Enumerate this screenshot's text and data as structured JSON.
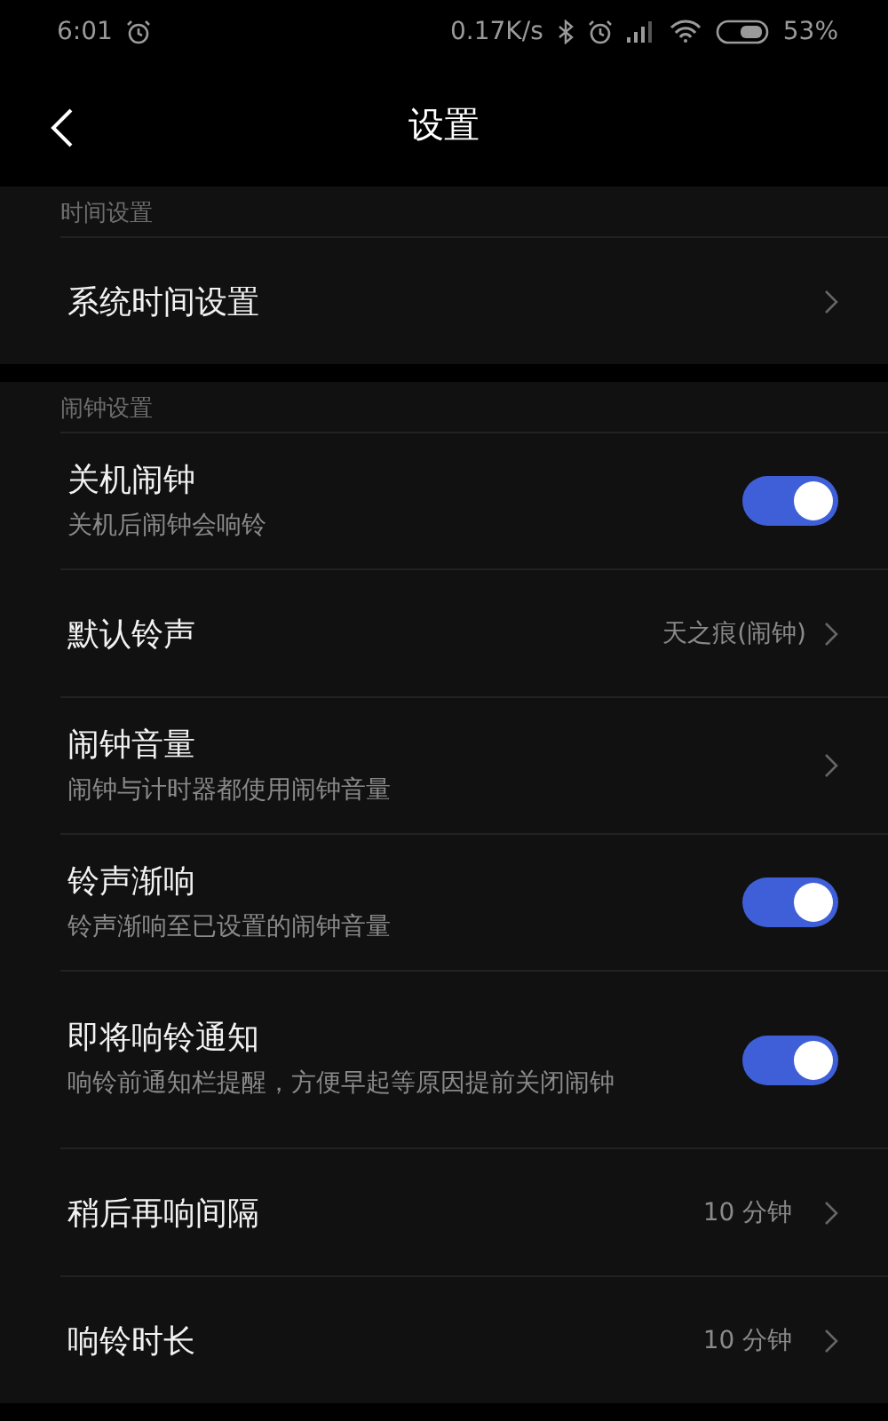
{
  "status_bar": {
    "time": "6:01",
    "speed": "0.17K/s",
    "battery": "53%"
  },
  "header": {
    "title": "设置"
  },
  "sections": [
    {
      "label": "时间设置",
      "items": [
        {
          "kind": "link",
          "title": "系统时间设置"
        }
      ]
    },
    {
      "label": "闹钟设置",
      "items": [
        {
          "kind": "toggle",
          "title": "关机闹钟",
          "subtitle": "关机后闹钟会响铃",
          "on": true
        },
        {
          "kind": "link",
          "title": "默认铃声",
          "value": "天之痕(闹钟)"
        },
        {
          "kind": "link",
          "title": "闹钟音量",
          "subtitle": "闹钟与计时器都使用闹钟音量"
        },
        {
          "kind": "toggle",
          "title": "铃声渐响",
          "subtitle": "铃声渐响至已设置的闹钟音量",
          "on": true
        },
        {
          "kind": "toggle",
          "title": "即将响铃通知",
          "subtitle": "响铃前通知栏提醒，方便早起等原因提前关闭闹钟",
          "on": true
        },
        {
          "kind": "link",
          "title": "稍后再响间隔",
          "value": "10 分钟"
        },
        {
          "kind": "link",
          "title": "响铃时长",
          "value": "10 分钟"
        }
      ]
    }
  ]
}
